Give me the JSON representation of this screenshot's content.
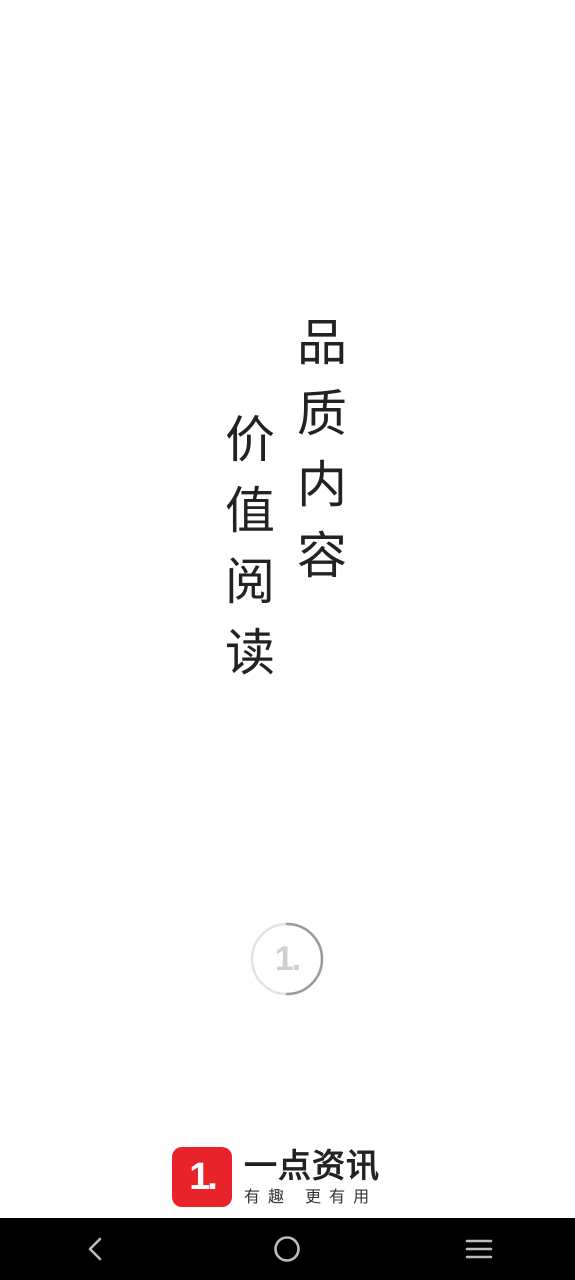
{
  "slogan": {
    "right": [
      "品",
      "质",
      "内",
      "容"
    ],
    "left": [
      "价",
      "值",
      "阅",
      "读"
    ]
  },
  "loader": {
    "label": "1."
  },
  "brand": {
    "logo_text": "1.",
    "name": "一点资讯",
    "slogan": "有趣 更有用",
    "logo_color": "#e8242a"
  },
  "navbar": {
    "back_icon": "back-icon",
    "home_icon": "home-icon",
    "menu_icon": "menu-icon"
  }
}
